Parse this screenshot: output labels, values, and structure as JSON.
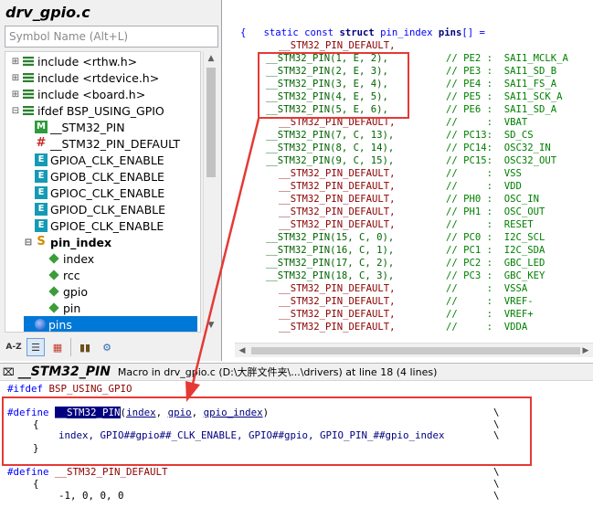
{
  "symbol_panel": {
    "file_title": "drv_gpio.c",
    "search_placeholder": "Symbol Name (Alt+L)",
    "tree": [
      {
        "label": "include <rthw.h>",
        "icon": "include-icon"
      },
      {
        "label": "include <rtdevice.h>",
        "icon": "include-icon"
      },
      {
        "label": "include <board.h>",
        "icon": "include-icon"
      },
      {
        "label": "ifdef BSP_USING_GPIO",
        "icon": "include-icon"
      },
      {
        "label": "__STM32_PIN",
        "icon": "macro-icon"
      },
      {
        "label": "__STM32_PIN_DEFAULT",
        "icon": "define-icon"
      },
      {
        "label": "GPIOA_CLK_ENABLE",
        "icon": "enum-icon"
      },
      {
        "label": "GPIOB_CLK_ENABLE",
        "icon": "enum-icon"
      },
      {
        "label": "GPIOC_CLK_ENABLE",
        "icon": "enum-icon"
      },
      {
        "label": "GPIOD_CLK_ENABLE",
        "icon": "enum-icon"
      },
      {
        "label": "GPIOE_CLK_ENABLE",
        "icon": "enum-icon"
      },
      {
        "label": "pin_index",
        "icon": "struct-icon"
      },
      {
        "label": "index",
        "icon": "field-icon"
      },
      {
        "label": "rcc",
        "icon": "field-icon"
      },
      {
        "label": "gpio",
        "icon": "field-icon"
      },
      {
        "label": "pin",
        "icon": "field-icon"
      },
      {
        "label": "pins",
        "icon": "variable-icon"
      }
    ],
    "toolbar": {
      "az": "A-Z"
    }
  },
  "code_view": {
    "header": [
      "static const ",
      "struct",
      " pin_index ",
      "pins",
      "[] ="
    ],
    "open_brace": "{",
    "lines": [
      {
        "macro": "__STM32_PIN_DEFAULT,",
        "default": true,
        "comment": ""
      },
      {
        "macro": "__STM32_PIN(1, E, 2),",
        "default": false,
        "comment": "// PE2 :  SAI1_MCLK_A"
      },
      {
        "macro": "__STM32_PIN(2, E, 3),",
        "default": false,
        "comment": "// PE3 :  SAI1_SD_B"
      },
      {
        "macro": "__STM32_PIN(3, E, 4),",
        "default": false,
        "comment": "// PE4 :  SAI1_FS_A"
      },
      {
        "macro": "__STM32_PIN(4, E, 5),",
        "default": false,
        "comment": "// PE5 :  SAI1_SCK_A"
      },
      {
        "macro": "__STM32_PIN(5, E, 6),",
        "default": false,
        "comment": "// PE6 :  SAI1_SD_A"
      },
      {
        "macro": "__STM32_PIN_DEFAULT,",
        "default": true,
        "comment": "//     :  VBAT"
      },
      {
        "macro": "__STM32_PIN(7, C, 13),",
        "default": false,
        "comment": "// PC13:  SD_CS"
      },
      {
        "macro": "__STM32_PIN(8, C, 14),",
        "default": false,
        "comment": "// PC14:  OSC32_IN"
      },
      {
        "macro": "__STM32_PIN(9, C, 15),",
        "default": false,
        "comment": "// PC15:  OSC32_OUT"
      },
      {
        "macro": "__STM32_PIN_DEFAULT,",
        "default": true,
        "comment": "//     :  VSS"
      },
      {
        "macro": "__STM32_PIN_DEFAULT,",
        "default": true,
        "comment": "//     :  VDD"
      },
      {
        "macro": "__STM32_PIN_DEFAULT,",
        "default": true,
        "comment": "// PH0 :  OSC_IN"
      },
      {
        "macro": "__STM32_PIN_DEFAULT,",
        "default": true,
        "comment": "// PH1 :  OSC_OUT"
      },
      {
        "macro": "__STM32_PIN_DEFAULT,",
        "default": true,
        "comment": "//     :  RESET"
      },
      {
        "macro": "__STM32_PIN(15, C, 0),",
        "default": false,
        "comment": "// PC0 :  I2C_SCL"
      },
      {
        "macro": "__STM32_PIN(16, C, 1),",
        "default": false,
        "comment": "// PC1 :  I2C_SDA"
      },
      {
        "macro": "__STM32_PIN(17, C, 2),",
        "default": false,
        "comment": "// PC2 :  GBC_LED"
      },
      {
        "macro": "__STM32_PIN(18, C, 3),",
        "default": false,
        "comment": "// PC3 :  GBC_KEY"
      },
      {
        "macro": "__STM32_PIN_DEFAULT,",
        "default": true,
        "comment": "//     :  VSSA"
      },
      {
        "macro": "__STM32_PIN_DEFAULT,",
        "default": true,
        "comment": "//     :  VREF-"
      },
      {
        "macro": "__STM32_PIN_DEFAULT,",
        "default": true,
        "comment": "//     :  VREF+"
      },
      {
        "macro": "__STM32_PIN_DEFAULT,",
        "default": true,
        "comment": "//     :  VDDA"
      }
    ]
  },
  "info_panel": {
    "macro_name": "__STM32_PIN",
    "description": "Macro in drv_gpio.c (D:\\大胖文件夹\\...\\drivers) at line 18 (4 lines)",
    "ifdef": "#ifdef",
    "ifdef_arg": "BSP_USING_GPIO",
    "define_kw": "#define",
    "define_name": "__STM32_PIN",
    "params": [
      "index",
      "gpio",
      "gpio_index"
    ],
    "brace_open": "{",
    "body_line": "index, GPIO##gpio##_CLK_ENABLE, GPIO##gpio, GPIO_PIN_##gpio_index",
    "brace_close": "}",
    "define2_kw": "#define",
    "define2_name": "__STM32_PIN_DEFAULT",
    "body2": "-1, 0, 0, 0",
    "continuation": "\\"
  },
  "annotation_colors": {
    "box": "#e53935",
    "arrow": "#e53935"
  }
}
